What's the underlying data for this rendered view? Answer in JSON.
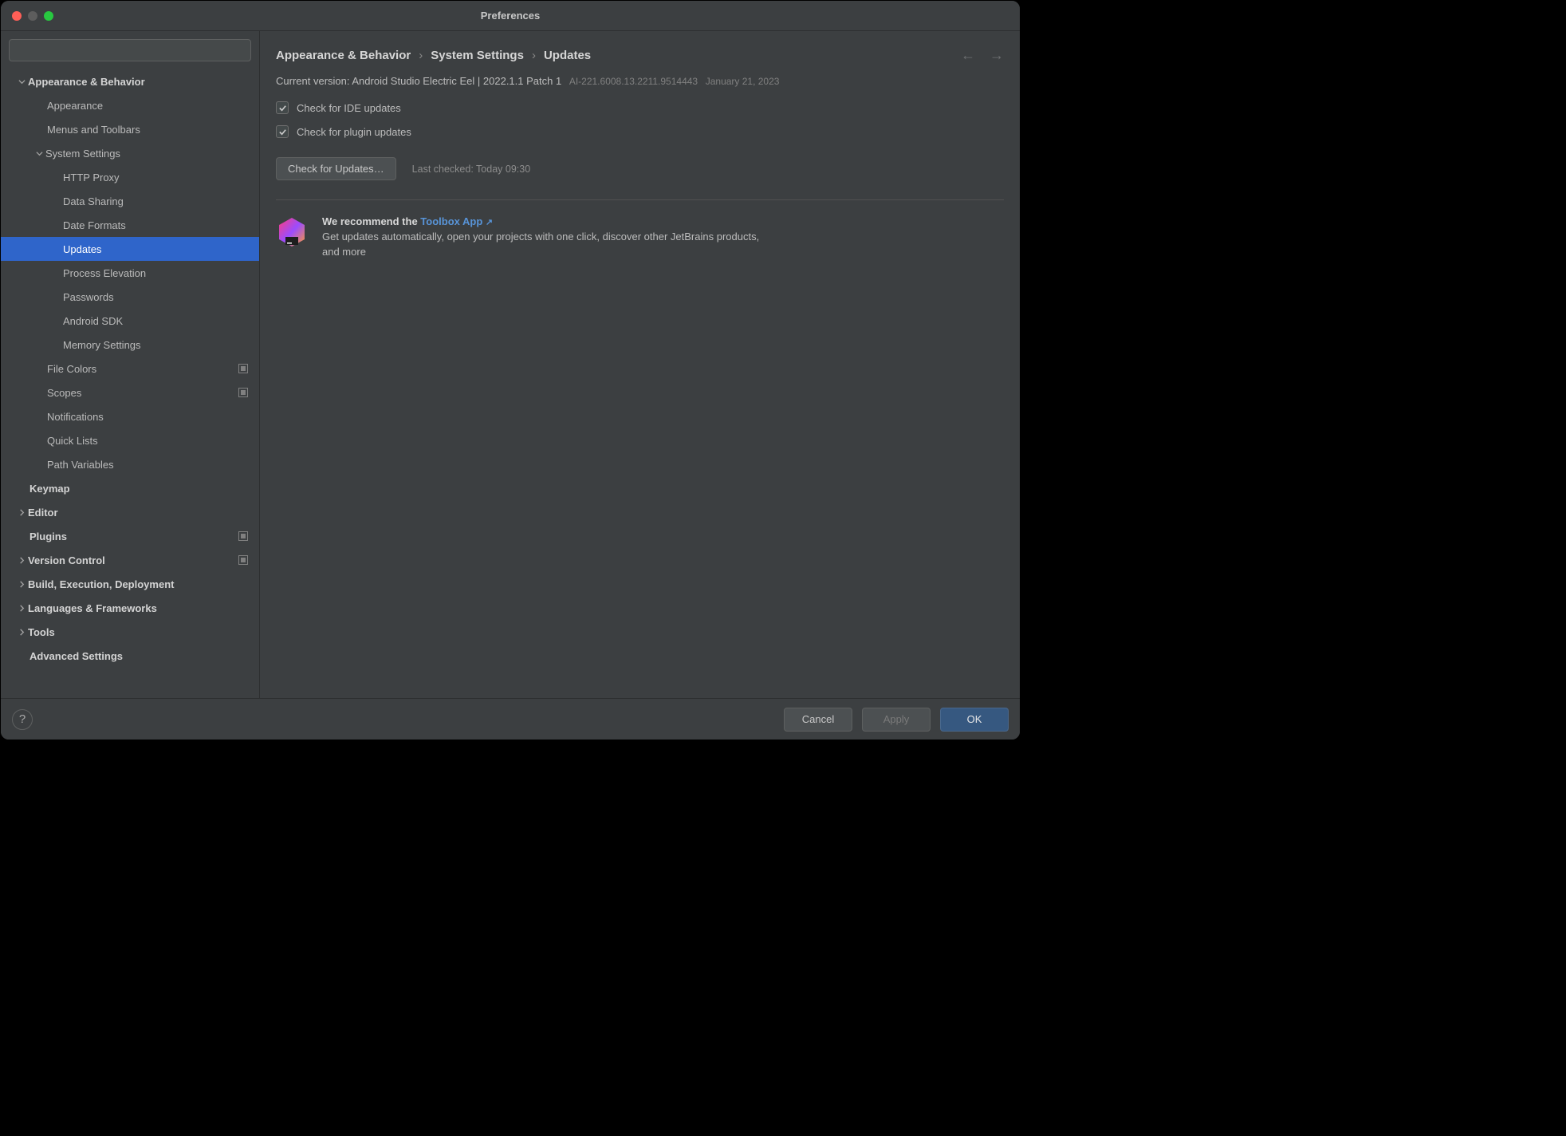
{
  "window": {
    "title": "Preferences"
  },
  "search": {
    "placeholder": ""
  },
  "breadcrumb": {
    "a": "Appearance & Behavior",
    "b": "System Settings",
    "c": "Updates"
  },
  "version": {
    "label": "Current version:",
    "value": "Android Studio Electric Eel | 2022.1.1 Patch 1",
    "build": "AI-221.6008.13.2211.9514443",
    "date": "January 21, 2023"
  },
  "checks": {
    "ide": "Check for IDE updates",
    "plugin": "Check for plugin updates"
  },
  "action": {
    "button": "Check for Updates…",
    "last": "Last checked: Today 09:30"
  },
  "promo": {
    "prefix": "We recommend the ",
    "link": "Toolbox App",
    "body": "Get updates automatically, open your projects with one click, discover other JetBrains products, and more"
  },
  "tree": {
    "appearance_behavior": "Appearance & Behavior",
    "appearance": "Appearance",
    "menus_toolbars": "Menus and Toolbars",
    "system_settings": "System Settings",
    "http_proxy": "HTTP Proxy",
    "data_sharing": "Data Sharing",
    "date_formats": "Date Formats",
    "updates": "Updates",
    "process_elevation": "Process Elevation",
    "passwords": "Passwords",
    "android_sdk": "Android SDK",
    "memory_settings": "Memory Settings",
    "file_colors": "File Colors",
    "scopes": "Scopes",
    "notifications": "Notifications",
    "quick_lists": "Quick Lists",
    "path_variables": "Path Variables",
    "keymap": "Keymap",
    "editor": "Editor",
    "plugins": "Plugins",
    "version_control": "Version Control",
    "build": "Build, Execution, Deployment",
    "languages": "Languages & Frameworks",
    "tools": "Tools",
    "advanced": "Advanced Settings"
  },
  "footer": {
    "cancel": "Cancel",
    "apply": "Apply",
    "ok": "OK"
  }
}
